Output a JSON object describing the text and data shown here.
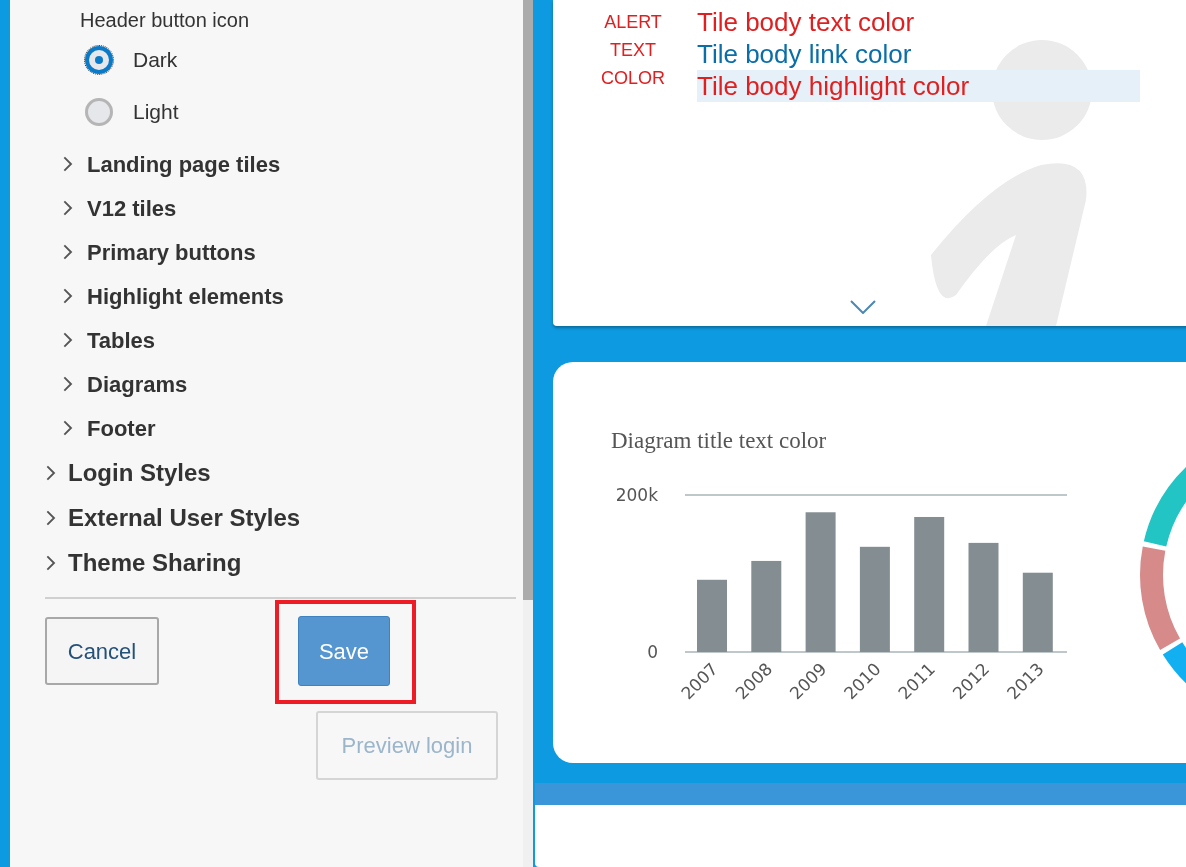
{
  "settings_panel": {
    "header_button_icon": {
      "label": "Header button icon",
      "options": [
        {
          "label": "Dark",
          "selected": true
        },
        {
          "label": "Light",
          "selected": false
        }
      ]
    },
    "subsections": [
      {
        "label": "Landing page tiles",
        "expanded": false
      },
      {
        "label": "V12 tiles",
        "expanded": false
      },
      {
        "label": "Primary buttons",
        "expanded": false
      },
      {
        "label": "Highlight elements",
        "expanded": false
      },
      {
        "label": "Tables",
        "expanded": false
      },
      {
        "label": "Diagrams",
        "expanded": false
      },
      {
        "label": "Footer",
        "expanded": false
      }
    ],
    "sections": [
      {
        "label": "Login Styles",
        "expanded": false
      },
      {
        "label": "External User Styles",
        "expanded": false
      },
      {
        "label": "Theme Sharing",
        "expanded": false
      }
    ],
    "buttons": {
      "cancel": {
        "label": "Cancel"
      },
      "save": {
        "label": "Save",
        "highlighted": true
      },
      "preview_login": {
        "label": "Preview login",
        "disabled": true
      }
    }
  },
  "tile_preview": {
    "alert_text": "ALERT TEXT COLOR",
    "lines": [
      {
        "text": "Tile body text color",
        "kind": "text"
      },
      {
        "text": "Tile body link color",
        "kind": "link"
      },
      {
        "text": "Tile body highlight color",
        "kind": "highlight"
      }
    ]
  },
  "diagram_card": {
    "title": "Diagram title text color",
    "chart_data": {
      "type": "bar",
      "categories": [
        "2007",
        "2008",
        "2009",
        "2010",
        "2011",
        "2012",
        "2013"
      ],
      "series": [
        {
          "color": "#848e92",
          "values": [
            92000,
            116000,
            178000,
            134000,
            172000,
            139000,
            101000
          ]
        }
      ],
      "ylim": [
        0,
        200000
      ],
      "yticks": [
        {
          "value": 0,
          "label": "0"
        },
        {
          "value": 200000,
          "label": "200k"
        }
      ]
    }
  }
}
